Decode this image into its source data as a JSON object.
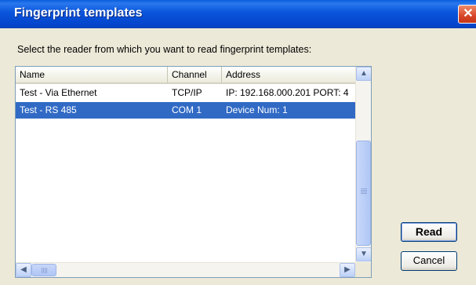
{
  "window": {
    "title": "Fingerprint templates",
    "close_glyph": "✕"
  },
  "prompt": "Select the reader from which you want to read fingerprint templates:",
  "table": {
    "columns": [
      "Name",
      "Channel",
      "Address"
    ],
    "rows": [
      {
        "name": "Test - Via Ethernet",
        "channel": "TCP/IP",
        "address": "IP: 192.168.000.201  PORT: 4"
      },
      {
        "name": "Test - RS 485",
        "channel": "COM 1",
        "address": "Device Num: 1"
      }
    ],
    "selected_row_index": 1
  },
  "scrollbar_glyphs": {
    "up": "▲",
    "down": "▼",
    "left": "◀",
    "right": "▶"
  },
  "buttons": {
    "read": "Read",
    "cancel": "Cancel"
  },
  "colors": {
    "selection": "#316ac5",
    "titlebar": "#0a55dc",
    "dialog_bg": "#ece9d8"
  }
}
